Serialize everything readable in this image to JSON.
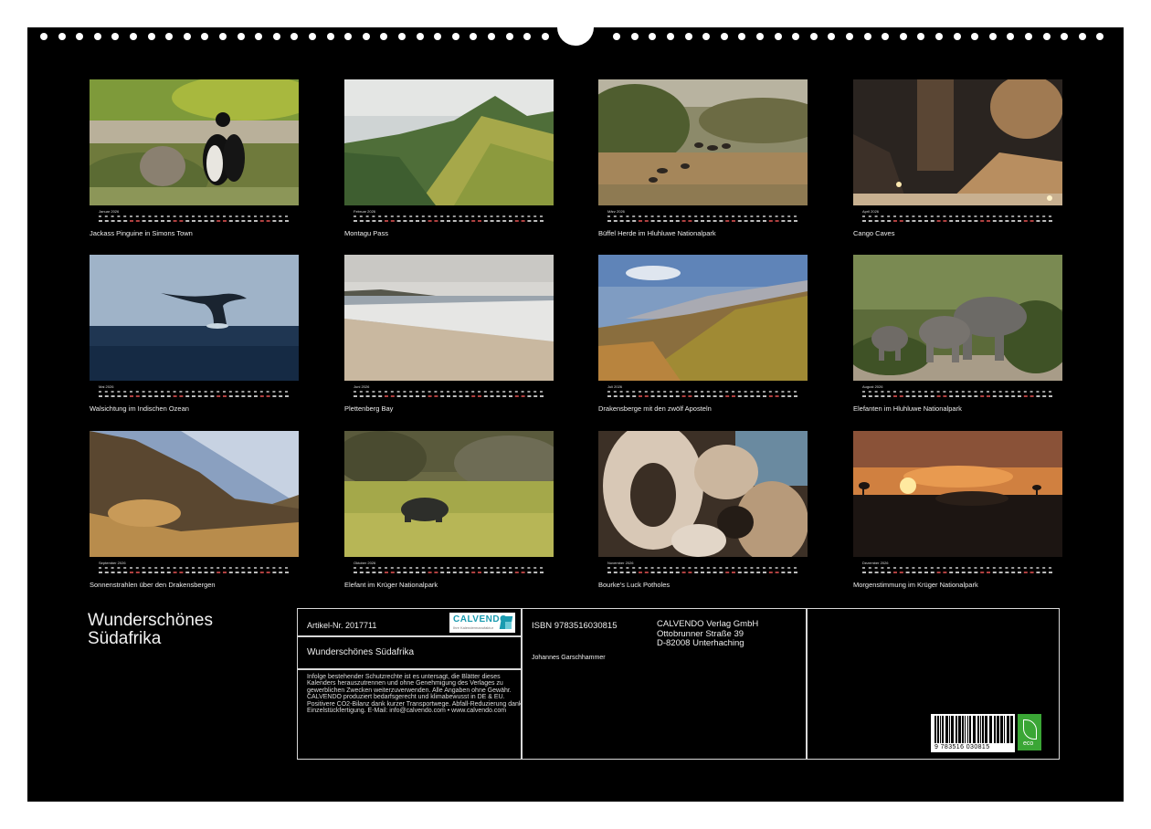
{
  "months": [
    {
      "name": "Januar 2026",
      "caption": "Jackass Pinguine in Simons Town",
      "scene": "penguins"
    },
    {
      "name": "Februar 2026",
      "caption": "Montagu Pass",
      "scene": "mountain"
    },
    {
      "name": "März 2026",
      "caption": "Büffel Herde im Hluhluwe Nationalpark",
      "scene": "buffalo"
    },
    {
      "name": "April 2026",
      "caption": "Cango Caves",
      "scene": "cave"
    },
    {
      "name": "Mai 2026",
      "caption": "Walsichtung im Indischen Ozean",
      "scene": "whale"
    },
    {
      "name": "Juni 2026",
      "caption": "Plettenberg Bay",
      "scene": "beach"
    },
    {
      "name": "Juli 2026",
      "caption": "Drakensberge mit den zwölf Aposteln",
      "scene": "drakensberg"
    },
    {
      "name": "August 2026",
      "caption": "Elefanten im Hluhluwe Nationalpark",
      "scene": "elephants"
    },
    {
      "name": "September 2026",
      "caption": "Sonnenstrahlen über den Drakensbergen",
      "scene": "sunrays"
    },
    {
      "name": "Oktober 2026",
      "caption": "Elefant im Krüger Nationalpark",
      "scene": "grass-elephant"
    },
    {
      "name": "November 2026",
      "caption": "Bourke's Luck Potholes",
      "scene": "potholes"
    },
    {
      "name": "Dezember 2026",
      "caption": "Morgenstimmung im Krüger Nationalpark",
      "scene": "sunset"
    }
  ],
  "title_line1": "Wunderschönes",
  "title_line2": "Südafrika",
  "article": "Artikel-Nr. 2017711",
  "subtitle": "Wunderschönes Südafrika",
  "isbn": "ISBN 9783516030815",
  "publisher": [
    "CALVENDO Verlag GmbH",
    "Ottobrunner Straße 39",
    "D-82008 Unterhaching"
  ],
  "author": "Johannes Garschhammer",
  "notice": "Infolge bestehender Schutzrechte ist es untersagt, die Blätter dieses Kalenders herauszutrennen und ohne Genehmigung des Verlages zu gewerblichen Zwecken weiterzuverwenden. Alle Angaben ohne Gewähr. CALVENDO produziert bedarfsgerecht und klimabewusst in DE & EU. Positivere CO2-Bilanz dank kurzer Transportwege. Abfall-Reduzierung dank Einzelstückfertigung. E-Mail: info@calvendo.com • www.calvendo.com",
  "logo_text": "CALVENDO",
  "logo_tagline": "Ihre Kalendermanufaktur",
  "barcode_number": "9 783516 030815",
  "eco_label": "eco",
  "colors": {
    "background": "#000000",
    "frame": "#d8d8d8",
    "text": "#eeeeee",
    "eco": "#3aa635",
    "logo_teal": "#1a9bb0"
  }
}
